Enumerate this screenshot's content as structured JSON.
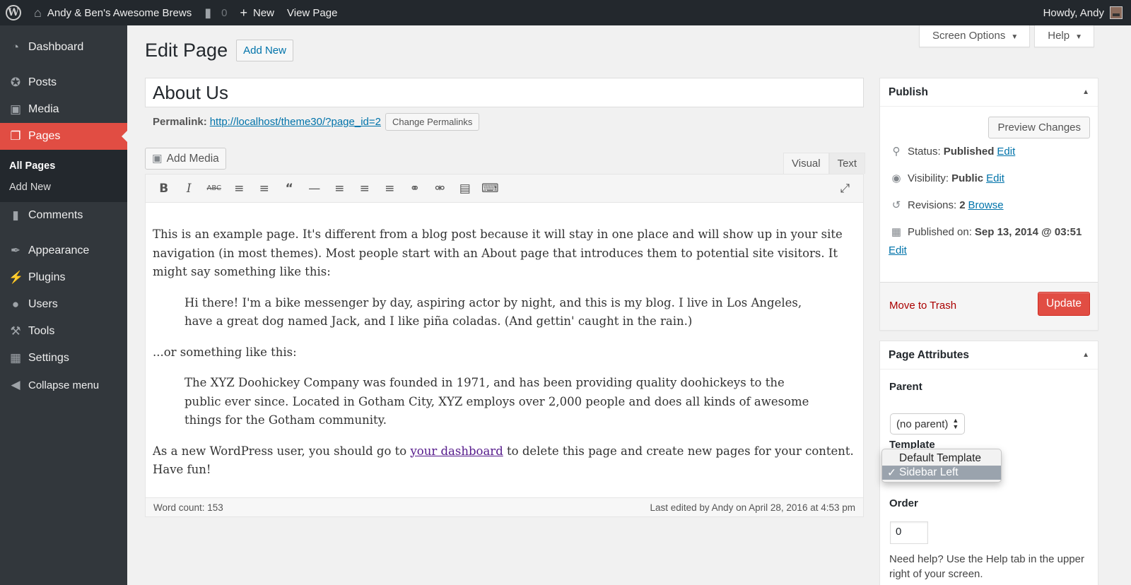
{
  "adminbar": {
    "site_name": "Andy & Ben's Awesome Brews",
    "comments_count": "0",
    "new_label": "New",
    "view_page_label": "View Page",
    "howdy": "Howdy, Andy"
  },
  "sidebar": {
    "items": [
      {
        "label": "Dashboard",
        "icon": "dashboard-icon"
      },
      {
        "label": "Posts",
        "icon": "pin-icon"
      },
      {
        "label": "Media",
        "icon": "media-icon"
      },
      {
        "label": "Pages",
        "icon": "pages-icon"
      },
      {
        "label": "Comments",
        "icon": "comment-icon"
      },
      {
        "label": "Appearance",
        "icon": "brush-icon"
      },
      {
        "label": "Plugins",
        "icon": "plug-icon"
      },
      {
        "label": "Users",
        "icon": "user-icon"
      },
      {
        "label": "Tools",
        "icon": "wrench-icon"
      },
      {
        "label": "Settings",
        "icon": "settings-icon"
      },
      {
        "label": "Collapse menu",
        "icon": "collapse-icon"
      }
    ],
    "pages_submenu": [
      "All Pages",
      "Add New"
    ],
    "accent_color": "#e14d43"
  },
  "header": {
    "screen_options": "Screen Options",
    "help": "Help",
    "title": "Edit Page",
    "add_new": "Add New"
  },
  "post": {
    "title": "About Us",
    "permalink_label": "Permalink:",
    "permalink_url": "http://localhost/theme30/?page_id=2",
    "change_permalinks": "Change Permalinks"
  },
  "editor": {
    "add_media": "Add Media",
    "tab_visual": "Visual",
    "tab_text": "Text",
    "paragraphs": {
      "p1": "This is an example page. It's different from a blog post because it will stay in one place and will show up in your site navigation (in most themes). Most people start with an About page that introduces them to potential site visitors. It might say something like this:",
      "q1": "Hi there! I'm a bike messenger by day, aspiring actor by night, and this is my blog. I live in Los Angeles, have a great dog named Jack, and I like piña coladas. (And gettin' caught in the rain.)",
      "p2": "...or something like this:",
      "q2": "The XYZ Doohickey Company was founded in 1971, and has been providing quality doohickeys to the public ever since. Located in Gotham City, XYZ employs over 2,000 people and does all kinds of awesome things for the Gotham community.",
      "p3_before": "As a new WordPress user, you should go to ",
      "p3_link": "your dashboard",
      "p3_after": " to delete this page and create new pages for your content. Have fun!"
    },
    "word_count": "Word count: 153",
    "last_edited": "Last edited by Andy on April 28, 2016 at 4:53 pm"
  },
  "publish": {
    "title": "Publish",
    "preview": "Preview Changes",
    "status_label": "Status:",
    "status_value": "Published",
    "visibility_label": "Visibility:",
    "visibility_value": "Public",
    "revisions_label": "Revisions:",
    "revisions_value": "2",
    "browse": "Browse",
    "published_on_label": "Published on:",
    "published_on_value": "Sep 13, 2014 @ 03:51",
    "edit": "Edit",
    "move_to_trash": "Move to Trash",
    "update": "Update"
  },
  "attributes": {
    "title": "Page Attributes",
    "parent_label": "Parent",
    "parent_value": "(no parent)",
    "template_label": "Template",
    "template_options": [
      "Default Template",
      "Sidebar Left"
    ],
    "template_selected": "Sidebar Left",
    "check": "✓",
    "order_label": "Order",
    "order_value": "0",
    "help_text": "Need help? Use the Help tab in the upper right of your screen."
  }
}
